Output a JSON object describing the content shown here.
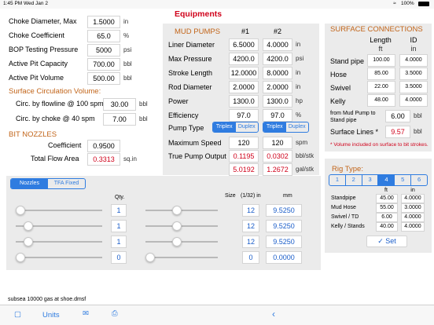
{
  "status_bar": {
    "time": "1:45 PM",
    "date": "Wed Jan 2",
    "battery": "100%"
  },
  "choke": {
    "rows": [
      {
        "label": "Choke Diameter, Max",
        "value": "1.5000",
        "unit": "in"
      },
      {
        "label": "Choke Coefficient",
        "value": "65.0",
        "unit": "%"
      },
      {
        "label": "BOP Testing Pressure",
        "value": "5000",
        "unit": "psi"
      },
      {
        "label": "Active Pit Capacity",
        "value": "700.00",
        "unit": "bbl"
      },
      {
        "label": "Active Pit Volume",
        "value": "500.00",
        "unit": "bbl"
      }
    ],
    "circ_title": "Surface Circulation Volume:",
    "circ_rows": [
      {
        "label": "Circ. by flowline @ 100 spm",
        "value": "30.00",
        "unit": "bbl"
      },
      {
        "label": "Circ. by choke @ 40 spm",
        "value": "7.00",
        "unit": "bbl"
      }
    ]
  },
  "bit_nozzles": {
    "title": "BIT NOZZLES",
    "coefficient_label": "Coefficient",
    "coefficient_value": "0.9500",
    "tfa_label": "Total Flow Area",
    "tfa_value": "0.3313",
    "tfa_unit": "sq.in"
  },
  "equipments": {
    "title": "Equipments",
    "mud_pumps_title": "MUD PUMPS",
    "col1": "#1",
    "col2": "#2",
    "rows": [
      {
        "label": "Liner Diameter",
        "v1": "6.5000",
        "v2": "4.0000",
        "unit": "in"
      },
      {
        "label": "Max Pressure",
        "v1": "4200.0",
        "v2": "4200.0",
        "unit": "psi"
      },
      {
        "label": "Stroke Length",
        "v1": "12.0000",
        "v2": "8.0000",
        "unit": "in"
      },
      {
        "label": "Rod Diameter",
        "v1": "2.0000",
        "v2": "2.0000",
        "unit": "in"
      },
      {
        "label": "Power",
        "v1": "1300.0",
        "v2": "1300.0",
        "unit": "hp"
      },
      {
        "label": "Efficiency",
        "v1": "97.0",
        "v2": "97.0",
        "unit": "%"
      }
    ],
    "pump_type_label": "Pump Type",
    "pump_type_options": [
      "Triplex",
      "Duplex"
    ],
    "max_speed_label": "Maximum Speed",
    "max_speed_v1": "120",
    "max_speed_v2": "120",
    "max_speed_unit": "spm",
    "tpo_label": "True Pump Output",
    "tpo_bbl_v1": "0.1195",
    "tpo_bbl_v2": "0.0302",
    "tpo_bbl_unit": "bbl/stk",
    "tpo_gal_v1": "5.0192",
    "tpo_gal_v2": "1.2672",
    "tpo_gal_unit": "gal/stk"
  },
  "surface": {
    "title": "SURFACE CONNECTIONS",
    "col_length": "Length",
    "col_length_unit": "ft",
    "col_id": "ID",
    "col_id_unit": "in",
    "rows": [
      {
        "label": "Stand pipe",
        "length": "100.00",
        "id": "4.0000"
      },
      {
        "label": "Hose",
        "length": "85.00",
        "id": "3.5000"
      },
      {
        "label": "Swivel",
        "length": "22.00",
        "id": "3.5000"
      },
      {
        "label": "Kelly",
        "length": "48.00",
        "id": "4.0000"
      }
    ],
    "from_pump_label": "from Mud Pump to Stand pipe",
    "from_pump_value": "6.00",
    "from_pump_unit": "bbl",
    "surface_lines_label": "Surface Lines *",
    "surface_lines_value": "9.57",
    "surface_lines_unit": "bbl",
    "note": "* Volume included on surface to bit strokes."
  },
  "rig_type": {
    "title": "Rig Type:",
    "options": [
      "1",
      "2",
      "3",
      "4",
      "5",
      "6"
    ],
    "selected": "4",
    "col_ft": "ft",
    "col_in": "in",
    "rows": [
      {
        "label": "Standpipe",
        "ft": "45.00",
        "in": "4.0000"
      },
      {
        "label": "Mud Hose",
        "ft": "55.00",
        "in": "3.0000"
      },
      {
        "label": "Swivel / TD",
        "ft": "6.00",
        "in": "4.0000"
      },
      {
        "label": "Kelly / Stands",
        "ft": "40.00",
        "in": "4.0000"
      }
    ],
    "set_label": "Set"
  },
  "nozzles": {
    "tabs": [
      "Nozzles",
      "TFA Fixed"
    ],
    "active_tab": "Nozzles",
    "qty_header": "Qty.",
    "size_header": "Size",
    "size_unit": "(1/32) in",
    "mm_header": "mm",
    "rows": [
      {
        "qty": "1",
        "size": "12",
        "mm": "9.5250",
        "qty_level": 0.0,
        "size_level": 0.42
      },
      {
        "qty": "1",
        "size": "12",
        "mm": "9.5250",
        "qty_level": 0.1,
        "size_level": 0.42
      },
      {
        "qty": "1",
        "size": "12",
        "mm": "9.5250",
        "qty_level": 0.1,
        "size_level": 0.42
      },
      {
        "qty": "0",
        "size": "0",
        "mm": "0.0000",
        "qty_level": 0.0,
        "size_level": 0.0
      }
    ]
  },
  "file_name": "subsea 10000 gas at shoe.dmsf",
  "toolbar": {
    "units_label": "Units"
  },
  "colors": {
    "accent": "#2f7ce0",
    "red": "#d0021b",
    "orange": "#c2651a"
  }
}
